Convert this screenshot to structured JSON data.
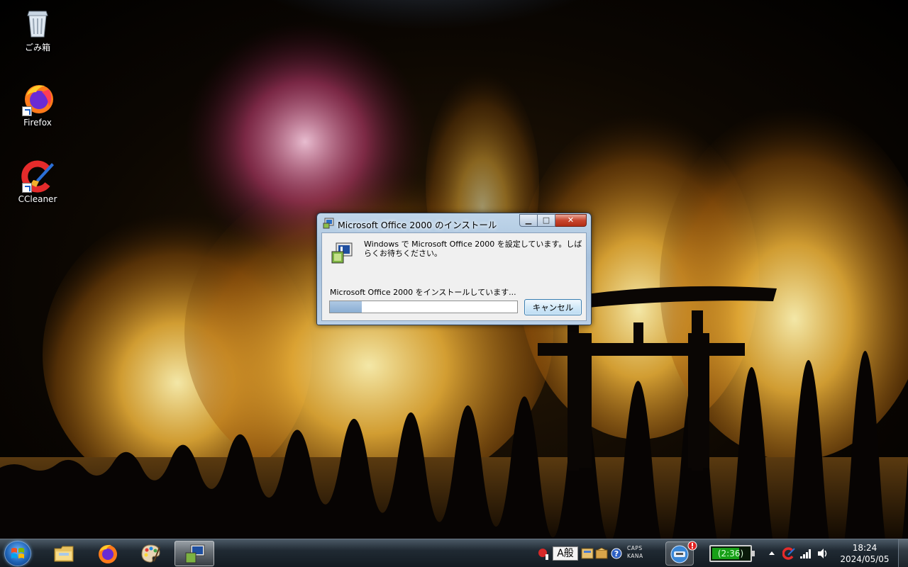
{
  "desktop": {
    "icons": [
      {
        "label": "ごみ箱",
        "icon": "recycle-bin-icon"
      },
      {
        "label": "Firefox",
        "icon": "firefox-icon"
      },
      {
        "label": "CCleaner",
        "icon": "ccleaner-icon"
      }
    ]
  },
  "dialog": {
    "title": "Microsoft Office 2000 のインストール",
    "message": "Windows で Microsoft Office 2000 を設定しています。しばらくお待ちください。",
    "status": "Microsoft Office 2000 をインストールしています...",
    "progress_fraction": 0.17,
    "cancel_label": "キャンセル",
    "caption_buttons": {
      "minimize": "minimize-icon",
      "maximize": "maximize-icon",
      "close": "close-icon"
    }
  },
  "taskbar": {
    "pinned": [
      {
        "name": "explorer",
        "icon": "folder-icon"
      },
      {
        "name": "firefox",
        "icon": "firefox-icon"
      },
      {
        "name": "paint",
        "icon": "palette-icon"
      },
      {
        "name": "office-setup",
        "icon": "setup-icon",
        "active": true
      }
    ],
    "ime": {
      "mode": "A",
      "kanji": "般",
      "caps": "CAPS",
      "kana": "KANA"
    },
    "battery_text": "(2:36)",
    "clock": {
      "time": "18:24",
      "date": "2024/05/05"
    }
  },
  "colors": {
    "accent": "#3c7fb1",
    "progress": "#8aaed3",
    "close": "#c8452d",
    "battery": "#18a018"
  }
}
